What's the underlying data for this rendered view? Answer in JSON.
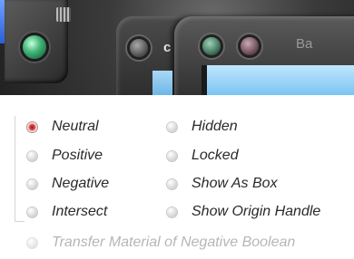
{
  "panel": {
    "visible_text": [
      "c",
      "Ba"
    ],
    "accent_colors": {
      "green_led": "#44b87a",
      "blue_edge": "#2b5fd6",
      "screen_blue": "#7cc4f2"
    }
  },
  "boolean_ops": {
    "items": [
      {
        "label": "Neutral",
        "selected": true
      },
      {
        "label": "Positive",
        "selected": false
      },
      {
        "label": "Negative",
        "selected": false
      },
      {
        "label": "Intersect",
        "selected": false
      }
    ]
  },
  "visibility": {
    "items": [
      {
        "label": "Hidden"
      },
      {
        "label": "Locked"
      },
      {
        "label": "Show As Box"
      },
      {
        "label": "Show Origin Handle"
      }
    ]
  },
  "transfer_option": {
    "label": "Transfer Material of Negative Boolean",
    "enabled": false
  },
  "colors": {
    "selected_radio": "#b31414",
    "label_text": "#2a2a2a",
    "disabled_text": "#b6b6b6"
  }
}
